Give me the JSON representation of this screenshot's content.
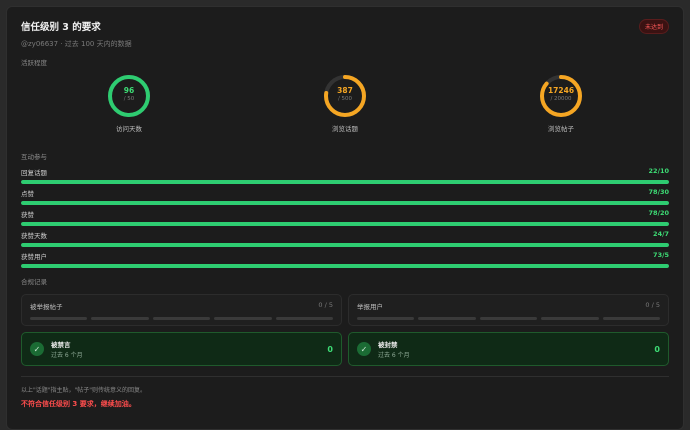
{
  "header": {
    "title": "信任级别 3 的要求",
    "badge": "未达到",
    "subtitle": "@zy06637 · 过去 100 天内的数据"
  },
  "activity": {
    "label": "活跃程度",
    "rings": [
      {
        "value": "96",
        "total": "/ 50",
        "label": "访问天数",
        "progress": 1.0,
        "color": "#2ecc71",
        "text_color": "#3ddc75"
      },
      {
        "value": "387",
        "total": "/ 500",
        "label": "浏览话题",
        "progress": 0.774,
        "color": "#f5a623",
        "text_color": "#f5a623"
      },
      {
        "value": "17246",
        "total": "/ 20000",
        "label": "浏览帖子",
        "progress": 0.862,
        "color": "#f5a623",
        "text_color": "#f5a623"
      }
    ]
  },
  "interaction": {
    "label": "互动参与",
    "bars": [
      {
        "name": "回复话题",
        "value": "22/10",
        "progress": 1.0
      },
      {
        "name": "点赞",
        "value": "78/30",
        "progress": 1.0
      },
      {
        "name": "获赞",
        "value": "78/20",
        "progress": 1.0
      },
      {
        "name": "获赞天数",
        "value": "24/7",
        "progress": 1.0
      },
      {
        "name": "获赞用户",
        "value": "73/5",
        "progress": 1.0
      }
    ]
  },
  "compliance": {
    "label": "合规记录",
    "reported_posts": {
      "label": "被举报帖子",
      "count": "0 / 5"
    },
    "reported_users": {
      "label": "举报用户",
      "count": "0 / 5"
    },
    "silenced": {
      "label": "被禁言",
      "sub": "过去 6 个月",
      "count": "0"
    },
    "suspended": {
      "label": "被封禁",
      "sub": "过去 6 个月",
      "count": "0"
    }
  },
  "footer": {
    "note": "以上\"话题\"指主贴，\"帖子\"则传统意义的回复。",
    "fail": "不符合信任级别 3 要求，继续加油。"
  },
  "colors": {
    "green": "#2ecc71",
    "orange": "#f5a623",
    "red": "#ff4d4d"
  }
}
